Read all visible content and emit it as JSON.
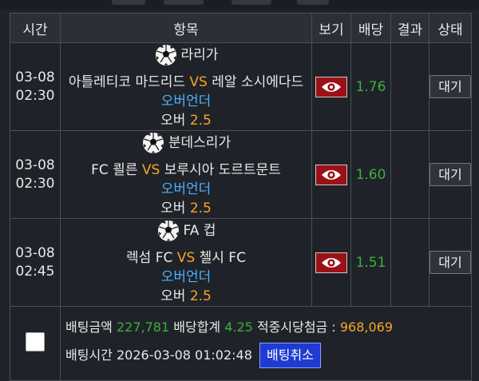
{
  "headers": [
    "시간",
    "항목",
    "보기",
    "배당",
    "결과",
    "상태"
  ],
  "games": [
    {
      "date": "03-08",
      "time": "02:30",
      "league": "라리가",
      "home": "아틀레티코 마드리드",
      "vs": "VS",
      "away": "레알 소시에다드",
      "market": "오버언더",
      "pick": "오버",
      "line": "2.5",
      "odds": "1.76",
      "status": "대기"
    },
    {
      "date": "03-08",
      "time": "02:30",
      "league": "분데스리가",
      "home": "FC 쾰른",
      "vs": "VS",
      "away": "보루시아 도르트문트",
      "market": "오버언더",
      "pick": "오버",
      "line": "2.5",
      "odds": "1.60",
      "status": "대기"
    },
    {
      "date": "03-08",
      "time": "02:45",
      "league": "FA 컵",
      "home": "렉섬 FC",
      "vs": "VS",
      "away": "첼시 FC",
      "market": "오버언더",
      "pick": "오버",
      "line": "2.5",
      "odds": "1.51",
      "status": "대기"
    }
  ],
  "summary": {
    "bet_amount_label": "배팅금액",
    "bet_amount": "227,781",
    "total_odds_label": "배당합계",
    "total_odds": "4.25",
    "payout_label": "적중시당첨금 :",
    "payout": "968,069",
    "bet_time_label": "배팅시간",
    "bet_time": "2026-03-08 01:02:48",
    "cancel_label": "배팅취소"
  },
  "colors": {
    "accent_orange": "#f5a623",
    "odds_green": "#3fae3f",
    "market_blue": "#4fb0ff",
    "eye_button_red": "#9b1115",
    "cancel_button_blue": "#1f3bd1"
  },
  "icons": {
    "league": "soccer-ball-icon",
    "view": "eye-icon"
  }
}
